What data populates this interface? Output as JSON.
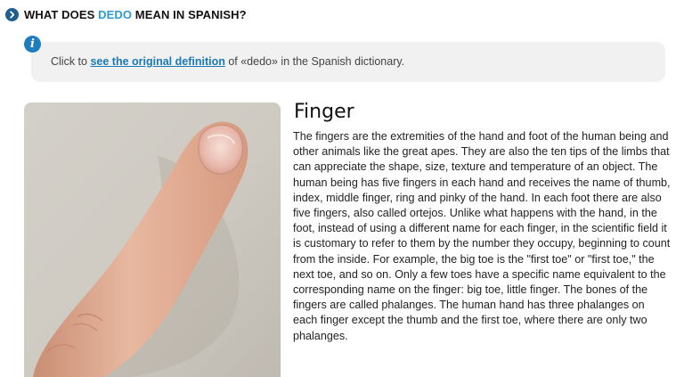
{
  "header": {
    "title_prefix": "WHAT DOES ",
    "title_keyword": "DEDO",
    "title_suffix": " MEAN IN SPANISH?",
    "icon": "chevron-right-circle-icon"
  },
  "info": {
    "icon": "info-circle-icon",
    "text_before": "Click to ",
    "link_label": "see the original definition",
    "text_after": " of «dedo» in the Spanish dictionary."
  },
  "definition": {
    "title": "Finger",
    "image": "finger-photo",
    "body": "The fingers are the extremities of the hand and foot of the human being and other animals like the great apes. They are also the ten tips of the limbs that can appreciate the shape, size, texture and temperature of an object. The human being has five fingers in each hand and receives the name of thumb, index, middle finger, ring and pinky of the hand. In each foot there are also five fingers, also called ortejos. Unlike what happens with the hand, in the foot, instead of using a different name for each finger, in the scientific field it is customary to refer to them by the number they occupy, beginning to count from the inside. For example, the big toe is the \"first toe\" or \"first toe,\" the next toe, and so on. Only a few toes have a specific name equivalent to the corresponding name on the finger: big toe, little finger. The bones of the fingers are called phalanges. The human hand has three phalanges on each finger except the thumb and the first toe, where there are only two phalanges."
  },
  "colors": {
    "accent": "#2a9bd6",
    "icon_blue": "#1f5f8b",
    "link": "#1a7ab8",
    "info_bg": "#f1f1f1"
  }
}
